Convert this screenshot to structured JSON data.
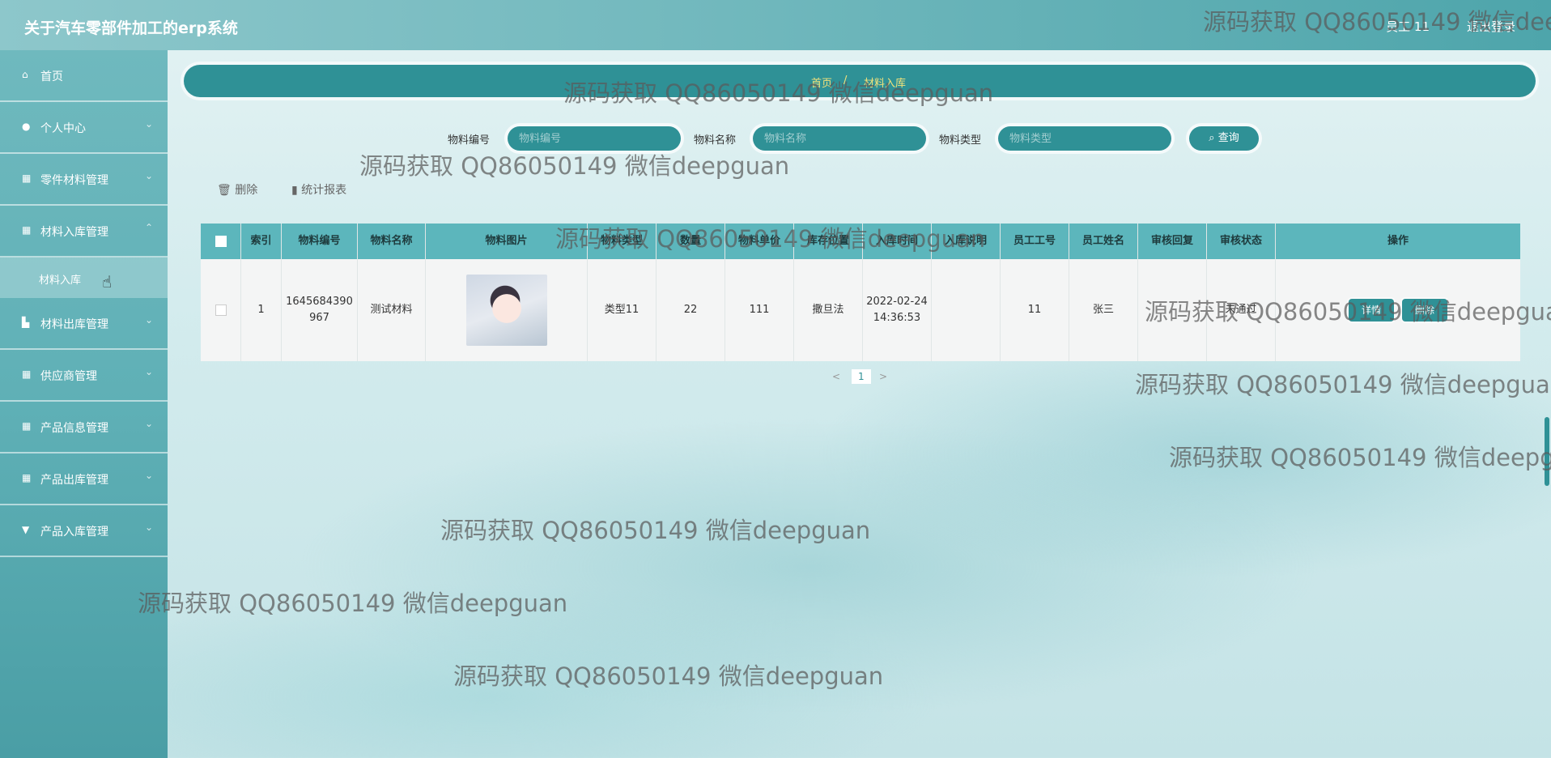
{
  "header": {
    "app_title": "关于汽车零部件加工的erp系统",
    "user_info": "员工 11",
    "logout_label": "退出登录"
  },
  "sidebar": {
    "items": [
      {
        "label": "首页",
        "icon": "home-icon"
      },
      {
        "label": "个人中心",
        "icon": "user-icon"
      },
      {
        "label": "零件材料管理",
        "icon": "grid-icon"
      },
      {
        "label": "材料入库管理",
        "icon": "grid-icon"
      },
      {
        "label": "材料出库管理",
        "icon": "factory-icon"
      },
      {
        "label": "供应商管理",
        "icon": "grid-icon"
      },
      {
        "label": "产品信息管理",
        "icon": "grid-icon"
      },
      {
        "label": "产品出库管理",
        "icon": "grid-icon"
      },
      {
        "label": "产品入库管理",
        "icon": "cup-icon"
      }
    ],
    "sub_item": "材料入库"
  },
  "breadcrumb": {
    "home": "首页",
    "separator": "/",
    "current": "材料入库"
  },
  "search": {
    "code_label": "物料编号",
    "code_placeholder": "物料编号",
    "name_label": "物料名称",
    "name_placeholder": "物料名称",
    "type_label": "物料类型",
    "type_placeholder": "物料类型",
    "button_label": "查询"
  },
  "toolbar": {
    "delete_label": "删除",
    "report_label": "统计报表"
  },
  "table": {
    "headers": [
      "索引",
      "物料编号",
      "物料名称",
      "物料图片",
      "物料类型",
      "数量",
      "物料单价",
      "库存位置",
      "入库时间",
      "入库说明",
      "员工工号",
      "员工姓名",
      "审核回复",
      "审核状态",
      "操作"
    ],
    "rows": [
      {
        "index": "1",
        "code": "1645684390967",
        "name": "测试材料",
        "type": "类型11",
        "quantity": "22",
        "price": "111",
        "location": "撒旦法",
        "time": "2022-02-24 14:36:53",
        "note": "",
        "staff_no": "11",
        "staff_name": "张三",
        "reply": "",
        "status": "未通过",
        "detail_label": "详情",
        "delete_label": "删除"
      }
    ]
  },
  "pagination": {
    "prev": "<",
    "page": "1",
    "next": ">"
  },
  "watermark": "源码获取 QQ86050149 微信deepguan",
  "colors": {
    "primary": "#2f9196",
    "header": "#5cb6bc",
    "breadcrumb_text": "#f3e27a"
  }
}
